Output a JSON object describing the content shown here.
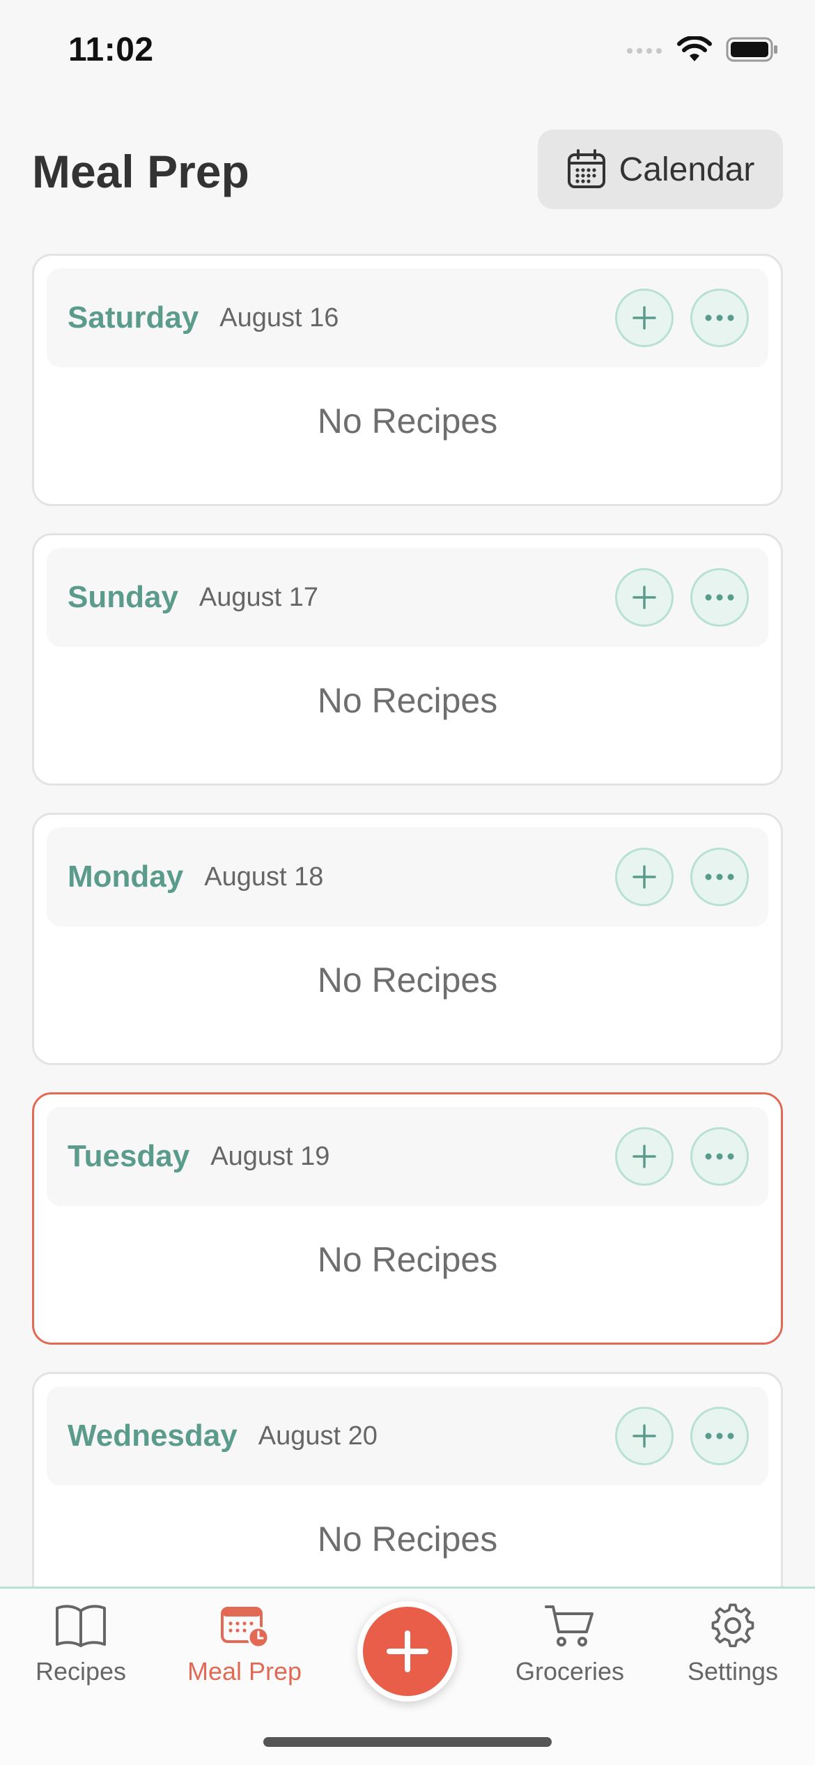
{
  "status_bar": {
    "time": "11:02"
  },
  "header": {
    "title": "Meal Prep",
    "calendar_label": "Calendar"
  },
  "days": [
    {
      "name": "Saturday",
      "date": "August 16",
      "empty_text": "No Recipes"
    },
    {
      "name": "Sunday",
      "date": "August 17",
      "empty_text": "No Recipes"
    },
    {
      "name": "Monday",
      "date": "August 18",
      "empty_text": "No Recipes"
    },
    {
      "name": "Tuesday",
      "date": "August 19",
      "empty_text": "No Recipes"
    },
    {
      "name": "Wednesday",
      "date": "August 20",
      "empty_text": "No Recipes"
    }
  ],
  "tabs": {
    "recipes": "Recipes",
    "meal_prep": "Meal Prep",
    "groceries": "Groceries",
    "settings": "Settings"
  },
  "colors": {
    "accent": "#e85e48",
    "day_name": "#5b9b8b",
    "action_bg": "#e7f4f0",
    "today_border": "#e26a55"
  }
}
